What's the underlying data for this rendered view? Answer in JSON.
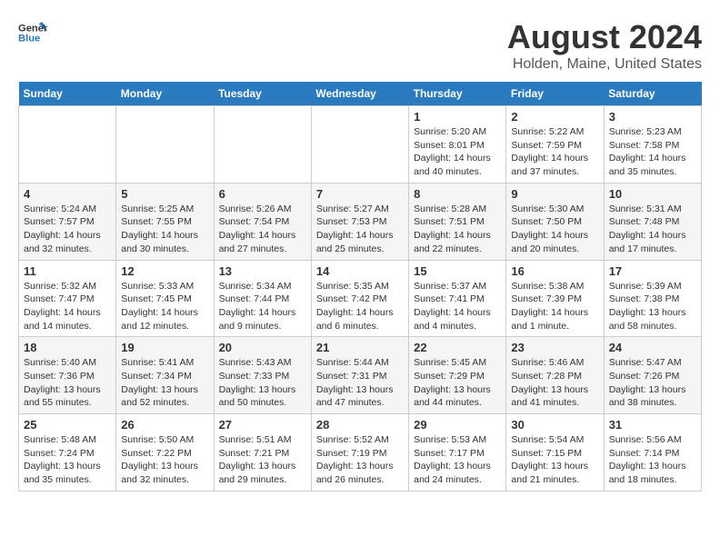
{
  "logo": {
    "line1": "General",
    "line2": "Blue"
  },
  "title": "August 2024",
  "subtitle": "Holden, Maine, United States",
  "days_of_week": [
    "Sunday",
    "Monday",
    "Tuesday",
    "Wednesday",
    "Thursday",
    "Friday",
    "Saturday"
  ],
  "weeks": [
    [
      {
        "day": "",
        "info": ""
      },
      {
        "day": "",
        "info": ""
      },
      {
        "day": "",
        "info": ""
      },
      {
        "day": "",
        "info": ""
      },
      {
        "day": "1",
        "info": "Sunrise: 5:20 AM\nSunset: 8:01 PM\nDaylight: 14 hours\nand 40 minutes."
      },
      {
        "day": "2",
        "info": "Sunrise: 5:22 AM\nSunset: 7:59 PM\nDaylight: 14 hours\nand 37 minutes."
      },
      {
        "day": "3",
        "info": "Sunrise: 5:23 AM\nSunset: 7:58 PM\nDaylight: 14 hours\nand 35 minutes."
      }
    ],
    [
      {
        "day": "4",
        "info": "Sunrise: 5:24 AM\nSunset: 7:57 PM\nDaylight: 14 hours\nand 32 minutes."
      },
      {
        "day": "5",
        "info": "Sunrise: 5:25 AM\nSunset: 7:55 PM\nDaylight: 14 hours\nand 30 minutes."
      },
      {
        "day": "6",
        "info": "Sunrise: 5:26 AM\nSunset: 7:54 PM\nDaylight: 14 hours\nand 27 minutes."
      },
      {
        "day": "7",
        "info": "Sunrise: 5:27 AM\nSunset: 7:53 PM\nDaylight: 14 hours\nand 25 minutes."
      },
      {
        "day": "8",
        "info": "Sunrise: 5:28 AM\nSunset: 7:51 PM\nDaylight: 14 hours\nand 22 minutes."
      },
      {
        "day": "9",
        "info": "Sunrise: 5:30 AM\nSunset: 7:50 PM\nDaylight: 14 hours\nand 20 minutes."
      },
      {
        "day": "10",
        "info": "Sunrise: 5:31 AM\nSunset: 7:48 PM\nDaylight: 14 hours\nand 17 minutes."
      }
    ],
    [
      {
        "day": "11",
        "info": "Sunrise: 5:32 AM\nSunset: 7:47 PM\nDaylight: 14 hours\nand 14 minutes."
      },
      {
        "day": "12",
        "info": "Sunrise: 5:33 AM\nSunset: 7:45 PM\nDaylight: 14 hours\nand 12 minutes."
      },
      {
        "day": "13",
        "info": "Sunrise: 5:34 AM\nSunset: 7:44 PM\nDaylight: 14 hours\nand 9 minutes."
      },
      {
        "day": "14",
        "info": "Sunrise: 5:35 AM\nSunset: 7:42 PM\nDaylight: 14 hours\nand 6 minutes."
      },
      {
        "day": "15",
        "info": "Sunrise: 5:37 AM\nSunset: 7:41 PM\nDaylight: 14 hours\nand 4 minutes."
      },
      {
        "day": "16",
        "info": "Sunrise: 5:38 AM\nSunset: 7:39 PM\nDaylight: 14 hours\nand 1 minute."
      },
      {
        "day": "17",
        "info": "Sunrise: 5:39 AM\nSunset: 7:38 PM\nDaylight: 13 hours\nand 58 minutes."
      }
    ],
    [
      {
        "day": "18",
        "info": "Sunrise: 5:40 AM\nSunset: 7:36 PM\nDaylight: 13 hours\nand 55 minutes."
      },
      {
        "day": "19",
        "info": "Sunrise: 5:41 AM\nSunset: 7:34 PM\nDaylight: 13 hours\nand 52 minutes."
      },
      {
        "day": "20",
        "info": "Sunrise: 5:43 AM\nSunset: 7:33 PM\nDaylight: 13 hours\nand 50 minutes."
      },
      {
        "day": "21",
        "info": "Sunrise: 5:44 AM\nSunset: 7:31 PM\nDaylight: 13 hours\nand 47 minutes."
      },
      {
        "day": "22",
        "info": "Sunrise: 5:45 AM\nSunset: 7:29 PM\nDaylight: 13 hours\nand 44 minutes."
      },
      {
        "day": "23",
        "info": "Sunrise: 5:46 AM\nSunset: 7:28 PM\nDaylight: 13 hours\nand 41 minutes."
      },
      {
        "day": "24",
        "info": "Sunrise: 5:47 AM\nSunset: 7:26 PM\nDaylight: 13 hours\nand 38 minutes."
      }
    ],
    [
      {
        "day": "25",
        "info": "Sunrise: 5:48 AM\nSunset: 7:24 PM\nDaylight: 13 hours\nand 35 minutes."
      },
      {
        "day": "26",
        "info": "Sunrise: 5:50 AM\nSunset: 7:22 PM\nDaylight: 13 hours\nand 32 minutes."
      },
      {
        "day": "27",
        "info": "Sunrise: 5:51 AM\nSunset: 7:21 PM\nDaylight: 13 hours\nand 29 minutes."
      },
      {
        "day": "28",
        "info": "Sunrise: 5:52 AM\nSunset: 7:19 PM\nDaylight: 13 hours\nand 26 minutes."
      },
      {
        "day": "29",
        "info": "Sunrise: 5:53 AM\nSunset: 7:17 PM\nDaylight: 13 hours\nand 24 minutes."
      },
      {
        "day": "30",
        "info": "Sunrise: 5:54 AM\nSunset: 7:15 PM\nDaylight: 13 hours\nand 21 minutes."
      },
      {
        "day": "31",
        "info": "Sunrise: 5:56 AM\nSunset: 7:14 PM\nDaylight: 13 hours\nand 18 minutes."
      }
    ]
  ]
}
